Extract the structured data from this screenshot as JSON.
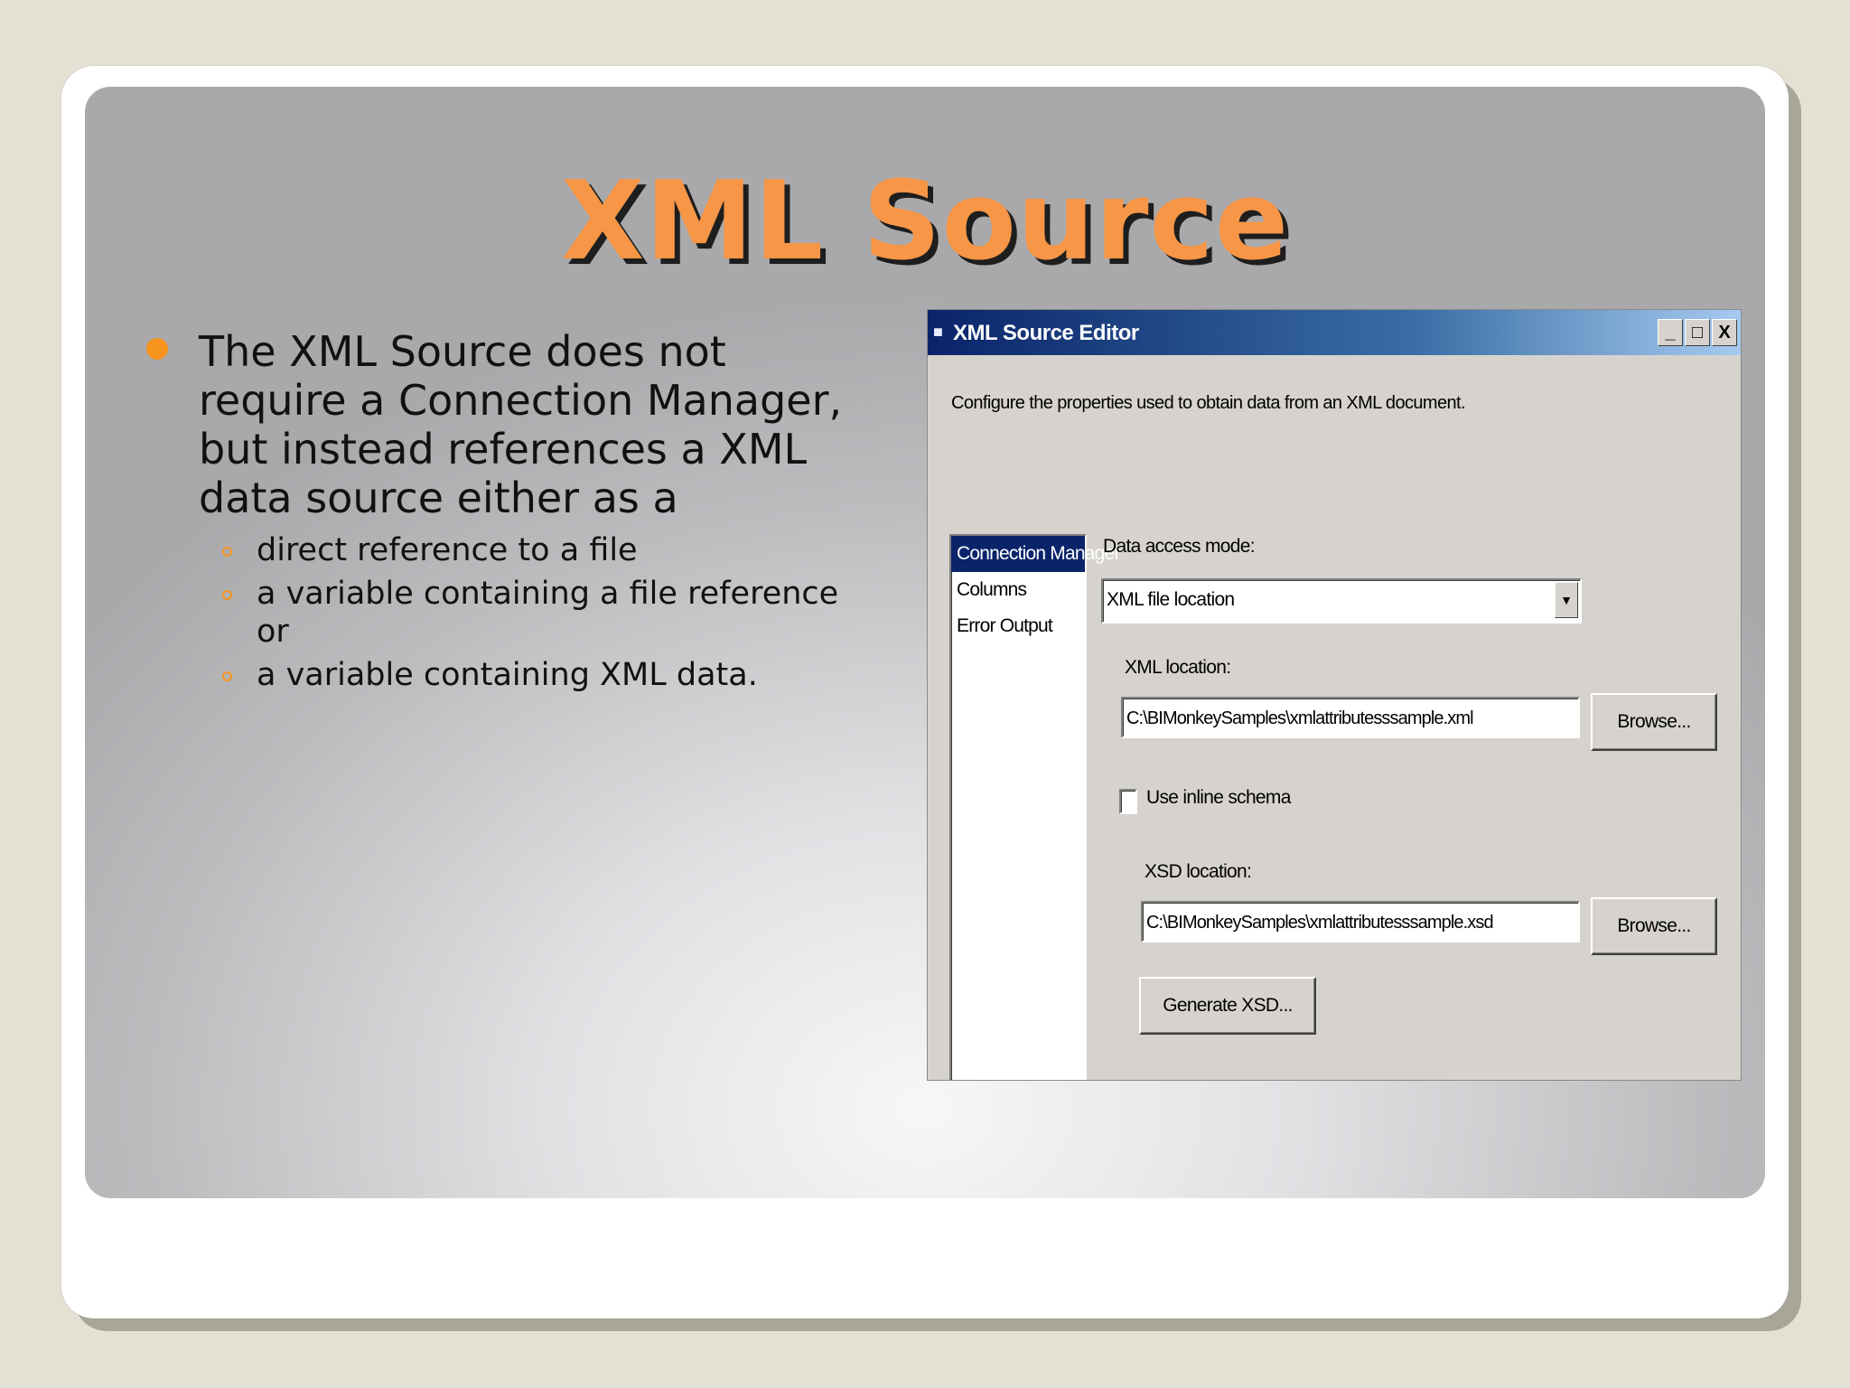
{
  "slide": {
    "title": "XML Source",
    "bullet_main": "The XML Source does not require a Connection Manager, but instead references a XML data source either as a",
    "sub_bullets": [
      "direct reference to a file",
      "a variable containing a file reference or",
      "a variable containing XML data."
    ],
    "accent_color": "#f79646"
  },
  "dialog": {
    "title": "XML Source Editor",
    "window_buttons": {
      "minimize": "_",
      "maximize": "□",
      "close": "X"
    },
    "description": "Configure the properties used to obtain data from an XML document.",
    "nav_items": [
      "Connection Manager",
      "Columns",
      "Error Output"
    ],
    "data_access_mode_label": "Data access mode:",
    "data_access_mode_value": "XML file location",
    "xml_location_label": "XML location:",
    "xml_location_value": "C:\\BIMonkeySamples\\xmlattributesssample.xml",
    "browse_label": "Browse...",
    "inline_schema_label": "Use inline schema",
    "xsd_location_label": "XSD location:",
    "xsd_location_value": "C:\\BIMonkeySamples\\xmlattributesssample.xsd",
    "generate_xsd_label": "Generate XSD..."
  }
}
